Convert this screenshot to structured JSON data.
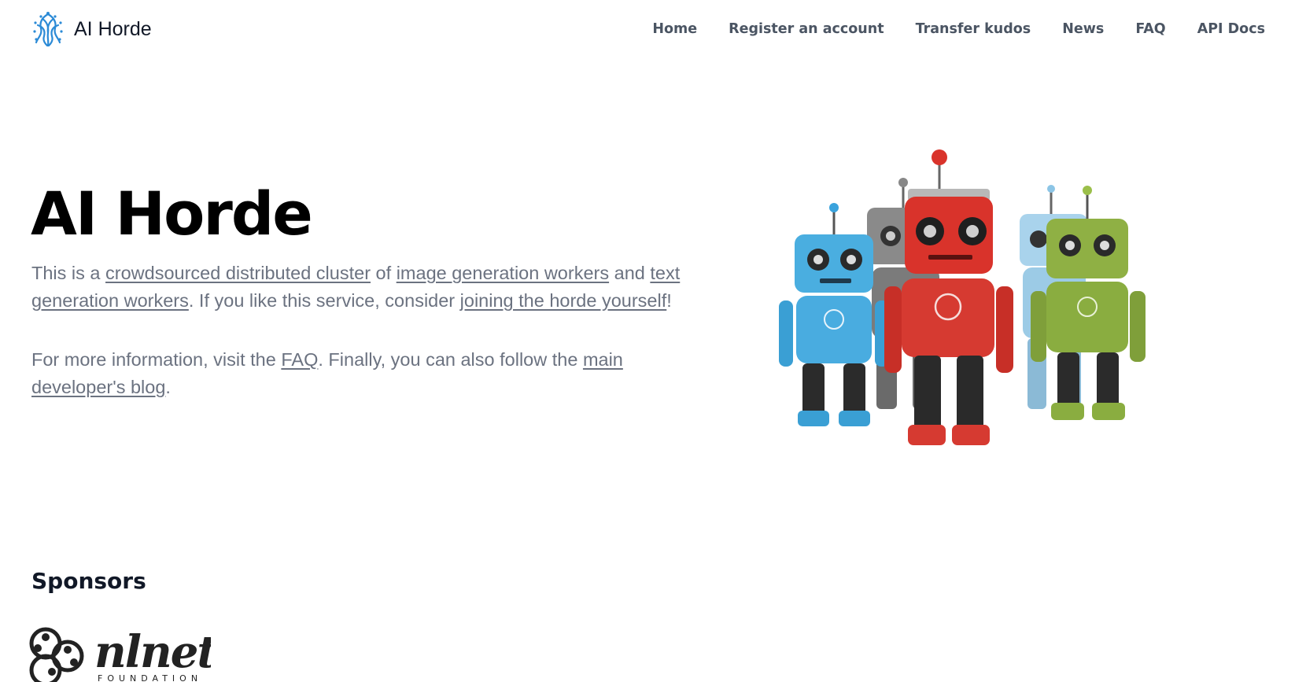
{
  "header": {
    "brand_name": "AI Horde",
    "brand_icon": "horde-logo-icon",
    "nav": [
      "Home",
      "Register an account",
      "Transfer kudos",
      "News",
      "FAQ",
      "API Docs"
    ]
  },
  "hero": {
    "title": "AI Horde",
    "p1": {
      "t1": "This is a ",
      "link1": "crowdsourced distributed cluster",
      "t2": " of ",
      "link2": "image generation workers",
      "t3": " and ",
      "link3": "text generation workers",
      "t4": ". If you like this service, consider ",
      "link4": "joining the horde yourself",
      "t5": "!"
    },
    "p2": {
      "t1": "For more information, visit the ",
      "link1": "FAQ",
      "t2": ". Finally, you can also follow the ",
      "link2": "main developer's blog",
      "t3": "."
    },
    "image": "robots-illustration"
  },
  "sponsors": {
    "title": "Sponsors",
    "logos": [
      {
        "name": "nlnet",
        "word": "nlnet",
        "sub": "FOUNDATION"
      }
    ]
  },
  "colors": {
    "text_dark": "#111827",
    "text_muted": "#6b7280",
    "nav_text": "#4b5563",
    "brand_blue": "#2b8ad6"
  }
}
